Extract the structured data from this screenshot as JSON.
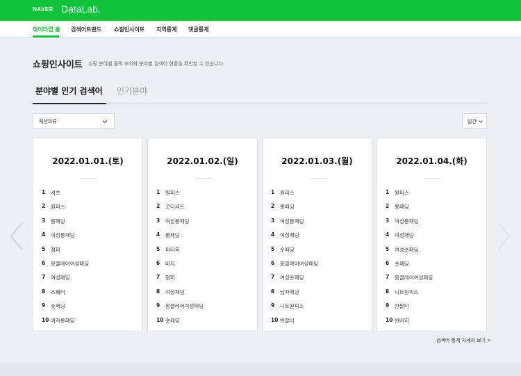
{
  "header": {
    "brand_naver": "NAVER",
    "brand_datalab": "DataLab."
  },
  "nav": {
    "items": [
      {
        "label": "데이터랩 홈",
        "active": true
      },
      {
        "label": "검색어트렌드",
        "active": false
      },
      {
        "label": "쇼핑인사이트",
        "active": false
      },
      {
        "label": "지역통계",
        "active": false
      },
      {
        "label": "댓글통계",
        "active": false
      }
    ]
  },
  "page": {
    "title": "쇼핑인사이트",
    "description": "쇼핑 분야별 클릭 추이와 분야별 검색어 현황을 확인할 수 있습니다."
  },
  "tabs": [
    {
      "label": "분야별 인기 검색어",
      "active": true
    },
    {
      "label": "인기분야",
      "active": false
    }
  ],
  "filters": {
    "category": "패션의류",
    "period": "일간"
  },
  "cards": [
    {
      "date": "2022.01.01.(토)",
      "items": [
        {
          "rank": "1",
          "keyword": "셔츠"
        },
        {
          "rank": "2",
          "keyword": "원피스"
        },
        {
          "rank": "3",
          "keyword": "롱패딩"
        },
        {
          "rank": "4",
          "keyword": "여성롱패딩"
        },
        {
          "rank": "5",
          "keyword": "점퍼"
        },
        {
          "rank": "6",
          "keyword": "몽클레어여성패딩"
        },
        {
          "rank": "7",
          "keyword": "여성패딩"
        },
        {
          "rank": "8",
          "keyword": "스웨터"
        },
        {
          "rank": "9",
          "keyword": "숏패딩"
        },
        {
          "rank": "10",
          "keyword": "여자롱패딩"
        }
      ]
    },
    {
      "date": "2022.01.02.(일)",
      "items": [
        {
          "rank": "1",
          "keyword": "원피스"
        },
        {
          "rank": "2",
          "keyword": "코디세트"
        },
        {
          "rank": "3",
          "keyword": "여성롱패딩"
        },
        {
          "rank": "4",
          "keyword": "롱패딩"
        },
        {
          "rank": "5",
          "keyword": "파티복"
        },
        {
          "rank": "6",
          "keyword": "바지"
        },
        {
          "rank": "7",
          "keyword": "점퍼"
        },
        {
          "rank": "8",
          "keyword": "여성패딩"
        },
        {
          "rank": "9",
          "keyword": "몽클레어여성패딩"
        },
        {
          "rank": "10",
          "keyword": "숏패딩"
        }
      ]
    },
    {
      "date": "2022.01.03.(월)",
      "items": [
        {
          "rank": "1",
          "keyword": "원피스"
        },
        {
          "rank": "2",
          "keyword": "롱패딩"
        },
        {
          "rank": "3",
          "keyword": "여성롱패딩"
        },
        {
          "rank": "4",
          "keyword": "여성패딩"
        },
        {
          "rank": "5",
          "keyword": "숏패딩"
        },
        {
          "rank": "6",
          "keyword": "몽클레어여성패딩"
        },
        {
          "rank": "7",
          "keyword": "여성숏패딩"
        },
        {
          "rank": "8",
          "keyword": "남자패딩"
        },
        {
          "rank": "9",
          "keyword": "니트원피스"
        },
        {
          "rank": "10",
          "keyword": "반팔티"
        }
      ]
    },
    {
      "date": "2022.01.04.(화)",
      "items": [
        {
          "rank": "1",
          "keyword": "원피스"
        },
        {
          "rank": "2",
          "keyword": "롱패딩"
        },
        {
          "rank": "3",
          "keyword": "여성롱패딩"
        },
        {
          "rank": "4",
          "keyword": "여성패딩"
        },
        {
          "rank": "5",
          "keyword": "여성숏패딩"
        },
        {
          "rank": "6",
          "keyword": "숏패딩"
        },
        {
          "rank": "7",
          "keyword": "몽클레어여성패딩"
        },
        {
          "rank": "8",
          "keyword": "니트원피스"
        },
        {
          "rank": "9",
          "keyword": "반팔티"
        },
        {
          "rank": "10",
          "keyword": "반바지"
        }
      ]
    }
  ],
  "more_link": "검색어 통계 자세히 보기 >",
  "colors": {
    "brand_green": "#10c33a",
    "background": "#eceff4"
  },
  "icons": {
    "prev": "chevron-left-icon",
    "next": "chevron-right-icon",
    "dropdown": "chevron-down-icon"
  }
}
